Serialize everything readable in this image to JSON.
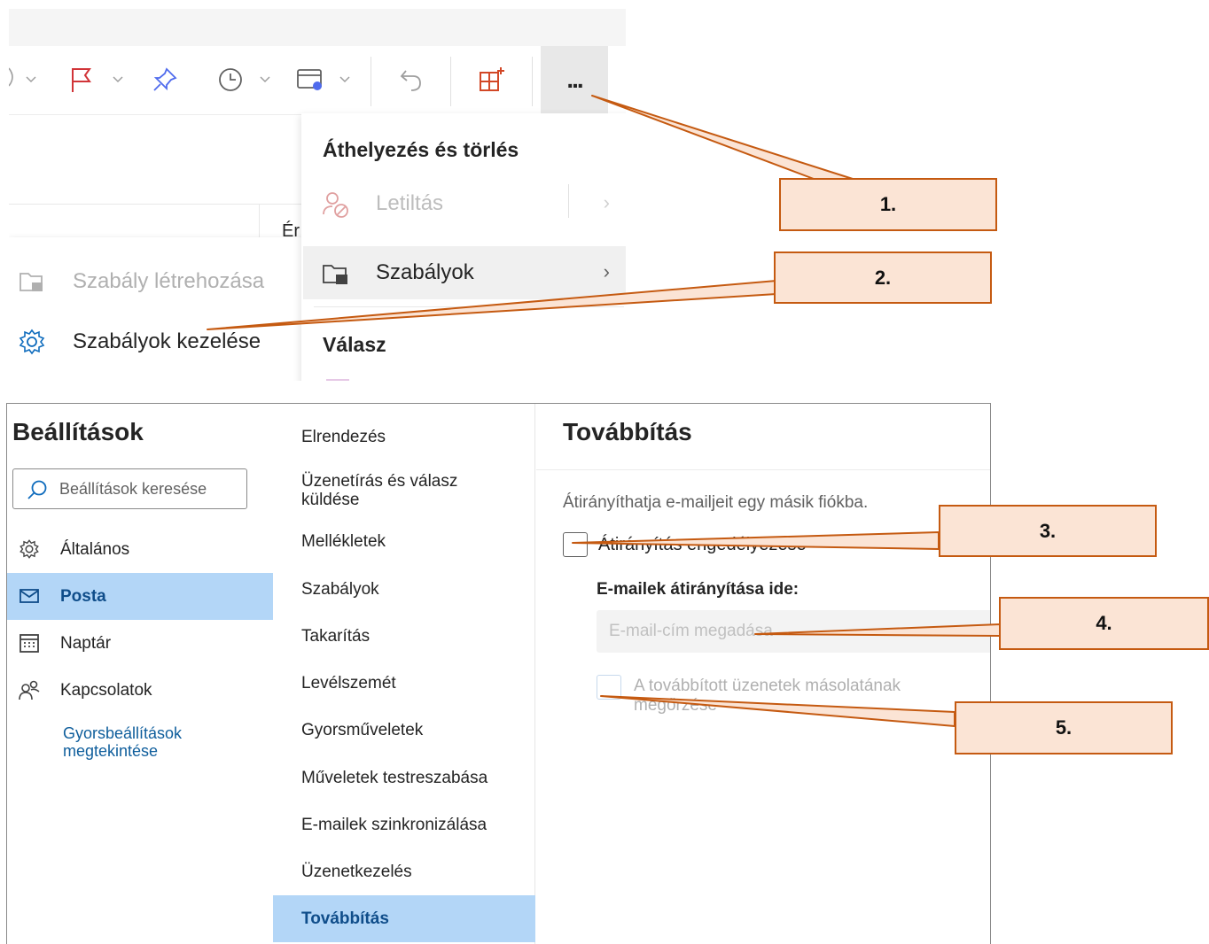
{
  "toolbar": {
    "more_label": "...",
    "icons": [
      "flag-icon",
      "pin-icon",
      "clock-icon",
      "rules-icon",
      "undo-icon",
      "apps-icon"
    ]
  },
  "more_menu": {
    "section_move": "Áthelyezés és törlés",
    "block_label": "Letiltás",
    "rules_label": "Szabályok",
    "section_reply": "Válasz",
    "chevron": "›"
  },
  "rules_submenu": {
    "create_rule": "Szabály létrehozása",
    "manage_rules": "Szabályok kezelése"
  },
  "hidden_col_fragment": "Ér",
  "settings": {
    "title": "Beállítások",
    "search_placeholder": "Beállítások keresése",
    "nav": [
      "Általános",
      "Posta",
      "Naptár",
      "Kapcsolatok"
    ],
    "quick_settings_link": "Gyorsbeállítások megtekintése",
    "mail_sections": [
      "Elrendezés",
      "Üzenetírás és válasz küldése",
      "Mellékletek",
      "Szabályok",
      "Takarítás",
      "Levélszemét",
      "Gyorsműveletek",
      "Műveletek testreszabása",
      "E-mailek szinkronizálása",
      "Üzenetkezelés",
      "Továbbítás"
    ]
  },
  "forwarding": {
    "title": "Továbbítás",
    "description": "Átirányíthatja e-mailjeit egy másik fiókba.",
    "enable_label": "Átirányítás engedélyezése",
    "redirect_to_label": "E-mailek átirányítása ide:",
    "email_placeholder": "E-mail-cím megadása",
    "keep_copy_label": "A továbbított üzenetek másolatának megőrzése"
  },
  "callouts": [
    "1.",
    "2.",
    "3.",
    "4.",
    "5."
  ],
  "colors": {
    "accent_selected": "#b3d6f7",
    "callout_fill": "#fbe4d5",
    "callout_stroke": "#c55a11",
    "flag_red": "#d13438",
    "link_blue": "#0f5e9c"
  }
}
